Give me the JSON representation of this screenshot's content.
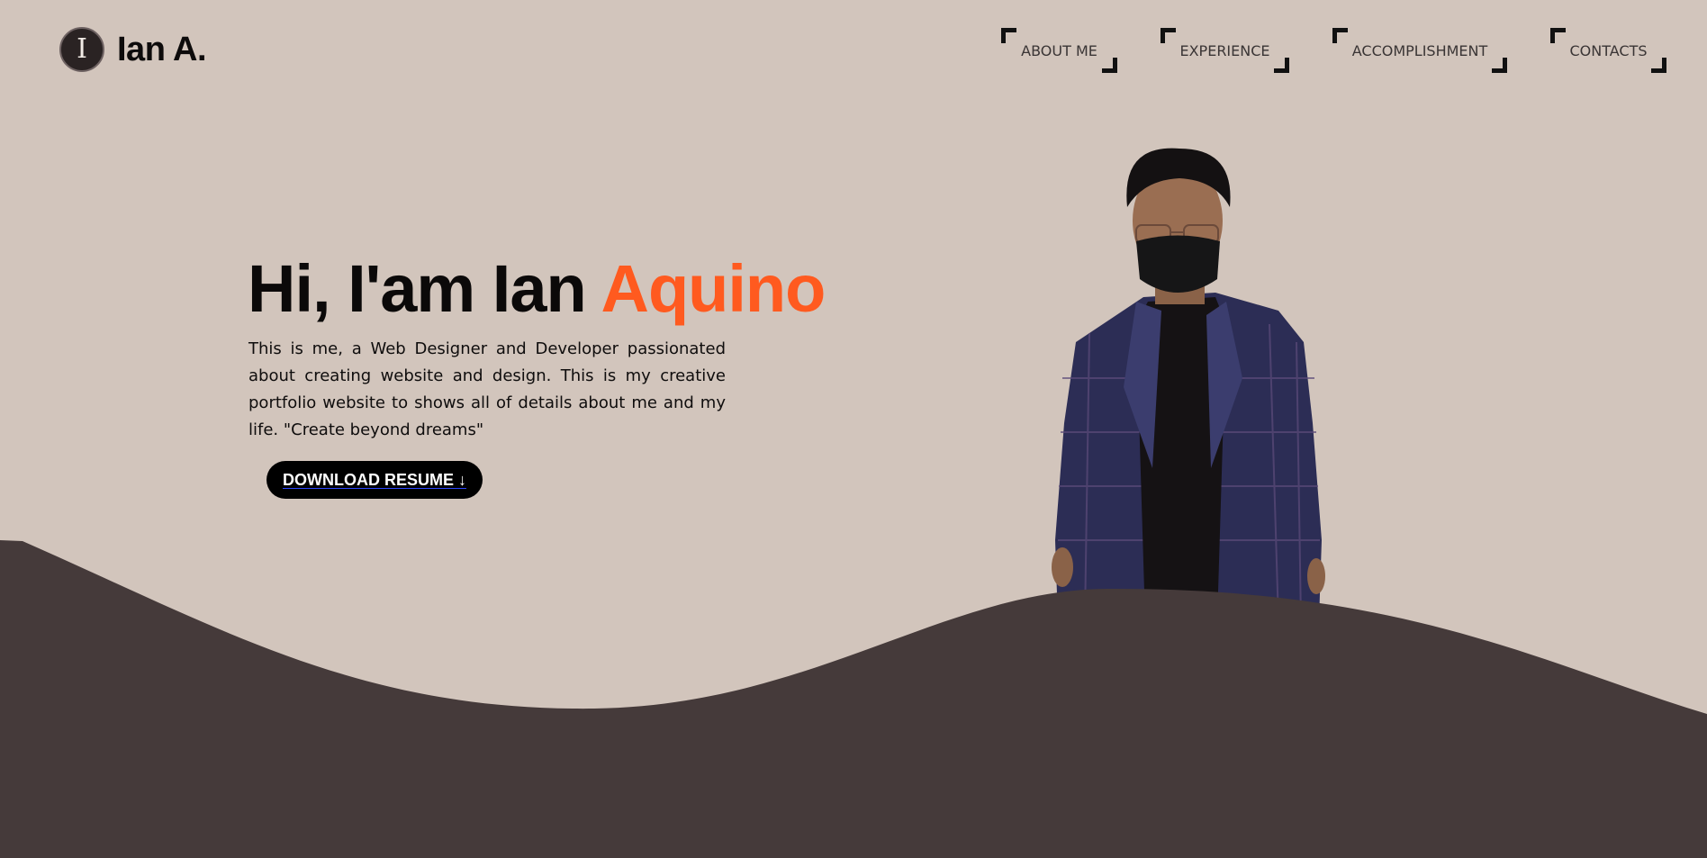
{
  "header": {
    "logo_letter": "I",
    "logo_name": "Ian A.",
    "nav": [
      {
        "label": "ABOUT ME"
      },
      {
        "label": "EXPERIENCE"
      },
      {
        "label": "ACCOMPLISHMENT"
      },
      {
        "label": "CONTACTS"
      }
    ]
  },
  "hero": {
    "title_prefix": "Hi, I'am Ian ",
    "title_accent": "Aquino",
    "description": "This is me, a Web Designer and Developer passionated about creating website and design. This is my creative portfolio website to shows all of details about me and my life. \"Create beyond dreams\"",
    "button_label": "DOWNLOAD RESUME ↓"
  },
  "colors": {
    "background": "#d2c5bc",
    "wave": "#453a3a",
    "accent": "#ff5a1f",
    "button": "#000000"
  }
}
